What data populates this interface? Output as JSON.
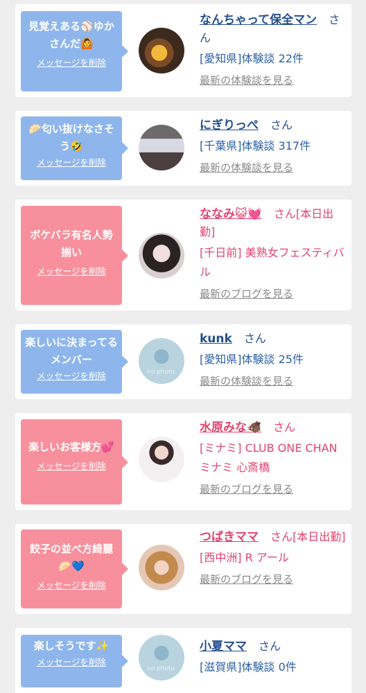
{
  "delete_label": "メッセージを削除",
  "suffix_san": "さん",
  "colors": {
    "blue_bubble": "#8fb6ec",
    "pink_bubble": "#f7909c",
    "blue_text": "#24508e",
    "pink_text": "#e2436d"
  },
  "cards": [
    {
      "message": "見覚えある⚾ゆかさんだ🙆",
      "name": "なんちゃって保全マン",
      "suffix": "さん",
      "info": "[愛知県]体験談 22件",
      "link": "最新の体験談を見る",
      "theme": "blue",
      "avatar": "beer-photo"
    },
    {
      "message": "🥟匂い抜けなさそう🤣",
      "name": "にぎりっぺ",
      "suffix": "さん",
      "info": "[千葉県]体験談 317件",
      "link": "最新の体験談を見る",
      "theme": "blue",
      "avatar": "room-photo"
    },
    {
      "message": "ボケバラ有名人勢揃い",
      "name": "ななみ😺💓",
      "suffix": "さん[本日出勤]",
      "info": "[千日前] 美熟女フェスティバル",
      "link": "最新のブログを見る",
      "theme": "pink",
      "avatar": "woman-photo"
    },
    {
      "message": "楽しいに決まってるメンバー",
      "name": "kunk",
      "suffix": "さん",
      "info": "[愛知県]体験談 25件",
      "link": "最新の体験談を見る",
      "theme": "blue",
      "avatar": "no-photo"
    },
    {
      "message": "楽しいお客様方💕",
      "name": "水原みな🐗",
      "suffix": "さん",
      "info": "[ミナミ] CLUB ONE CHAN ミナミ 心斎橋",
      "link": "最新のブログを見る",
      "theme": "pink",
      "avatar": "woman-white-photo"
    },
    {
      "message": "餃子の並べ方綺麗🥟💙",
      "name": "つばきママ",
      "suffix": "さん[本日出勤]",
      "info": "[西中洲] R アール",
      "link": "最新のブログを見る",
      "theme": "pink",
      "avatar": "woman-blonde-photo"
    },
    {
      "message": "楽しそうです✨",
      "name": "小夏ママ",
      "suffix": "さん",
      "info": "[滋賀県]体験談 0件",
      "link": "",
      "theme": "blue",
      "avatar": "no-photo"
    }
  ],
  "no_photo_text": "no photo"
}
